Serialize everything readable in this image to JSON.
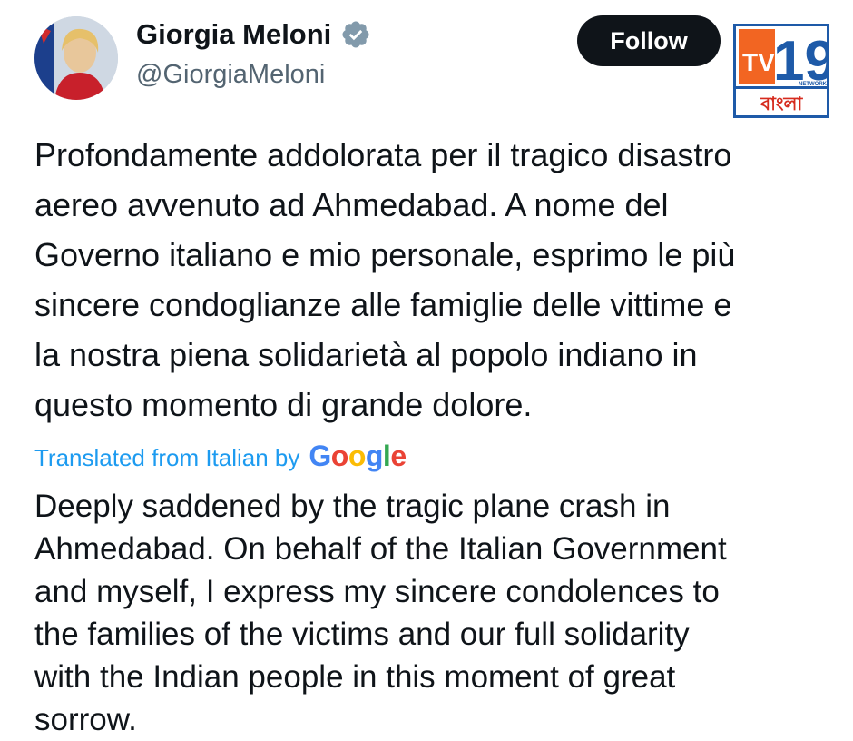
{
  "author": {
    "name": "Giorgia Meloni",
    "handle": "@GiorgiaMeloni",
    "verified_icon": "verified-badge-icon"
  },
  "follow_button": {
    "label": "Follow"
  },
  "watermark": {
    "brand_text": "TV19",
    "network_text": "NETWORK",
    "language_text": "বাংলা",
    "colors": {
      "orange": "#f26522",
      "blue": "#1e5aa8"
    }
  },
  "tweet": {
    "original_text": "Profondamente addolorata per il tragico disastro\naereo avvenuto ad Ahmedabad. A nome del\nGoverno italiano e mio personale, esprimo le più\nsincere condoglianze alle famiglie delle vittime e\nla nostra piena solidarietà al popolo indiano in\nquesto momento di grande dolore.",
    "translation_label": "Translated from Italian by",
    "translation_provider": [
      "G",
      "o",
      "o",
      "g",
      "l",
      "e"
    ],
    "translated_text": "Deeply saddened by the tragic plane crash in\nAhmedabad. On behalf of the Italian Government\nand myself, I express my sincere condolences to\nthe families of the victims and our full solidarity\nwith the Indian people in this moment of great\nsorrow."
  },
  "colors": {
    "link": "#1d9bf0",
    "text": "#0f1419",
    "secondary": "#536471"
  }
}
